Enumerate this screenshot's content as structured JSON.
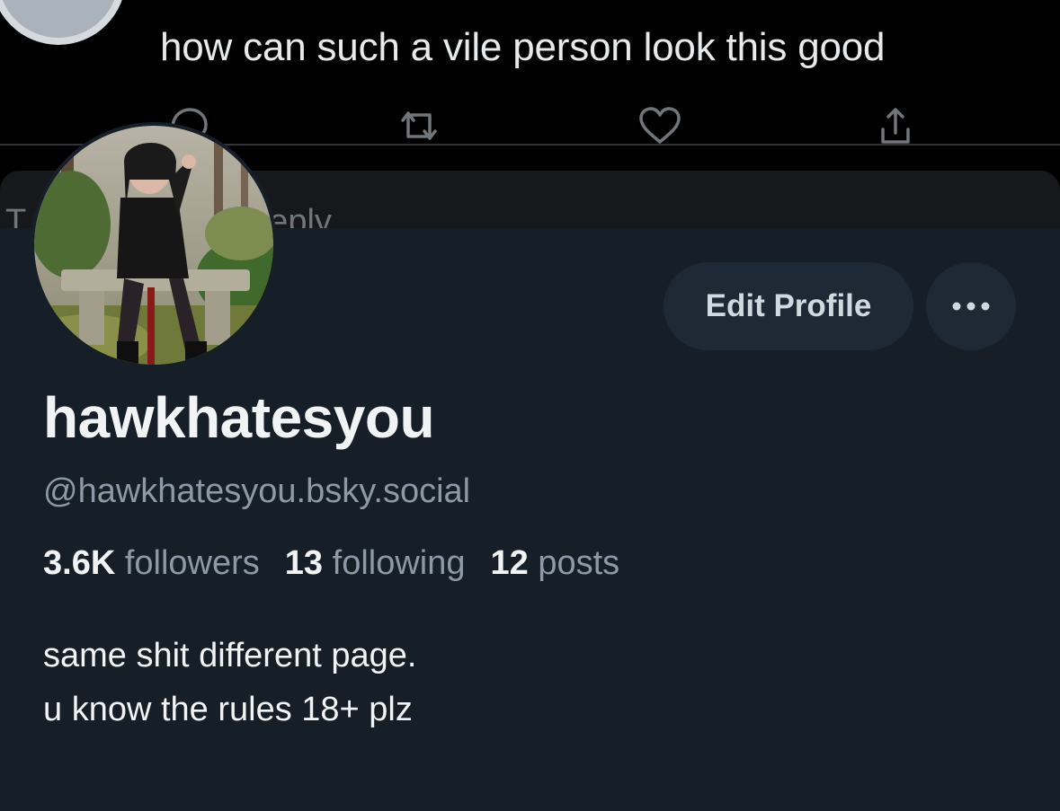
{
  "tweet": {
    "text": "how can such a vile person look this good",
    "actions": {
      "reply_icon": "reply-icon",
      "repost_icon": "repost-icon",
      "like_icon": "heart-icon",
      "share_icon": "share-icon"
    }
  },
  "reply_sheet": {
    "placeholder_fragment_start": "T",
    "placeholder_fragment_end": "eply"
  },
  "profile": {
    "display_name": "hawkhatesyou",
    "handle": "@hawkhatesyou.bsky.social",
    "stats": {
      "followers_count": "3.6K",
      "followers_label": "followers",
      "following_count": "13",
      "following_label": "following",
      "posts_count": "12",
      "posts_label": "posts"
    },
    "bio_lines": [
      "same shit different page.",
      "u know the rules 18+ plz"
    ],
    "edit_button_label": "Edit Profile",
    "more_button_icon": "more-dots-icon"
  },
  "colors": {
    "background_top": "#000000",
    "panel_background": "#161e27",
    "button_background": "#1e2936",
    "primary_text": "#f1f3f5",
    "secondary_text": "#8d99a6"
  }
}
